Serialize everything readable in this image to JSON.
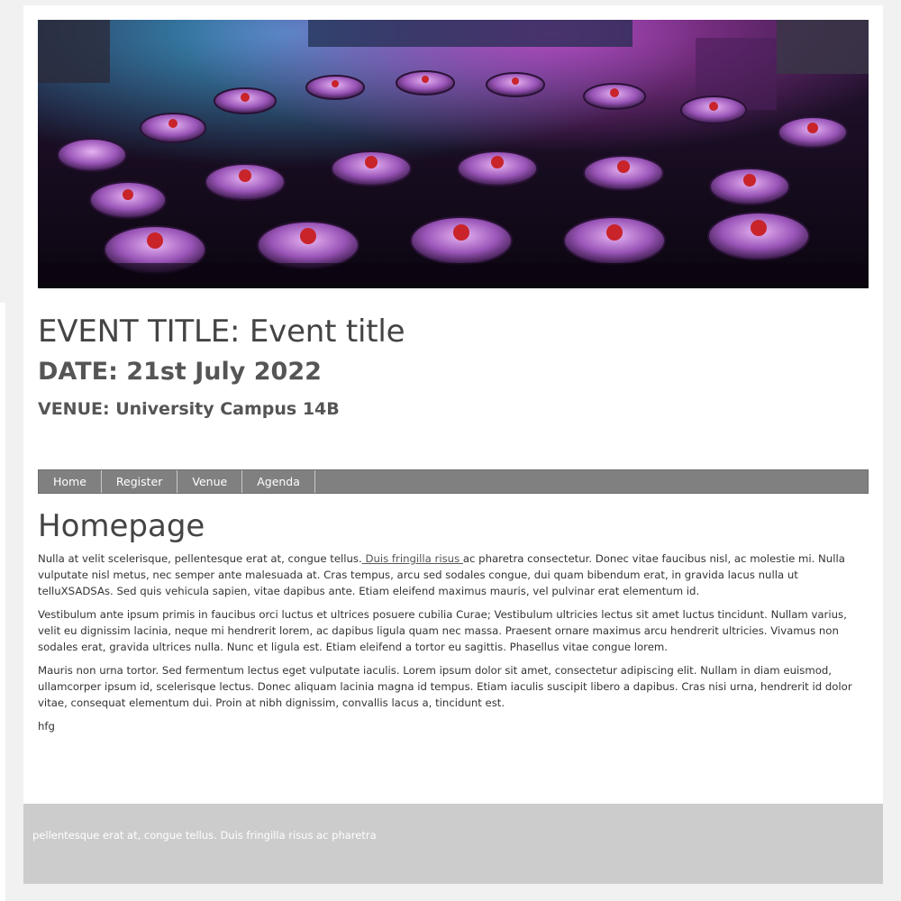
{
  "hero": {
    "image_label": "event-banner-banquet-hall"
  },
  "event": {
    "title": "EVENT TITLE: Event title",
    "date": "DATE: 21st July 2022",
    "venue": "VENUE: University Campus 14B"
  },
  "nav": {
    "items": [
      {
        "label": "Home"
      },
      {
        "label": "Register"
      },
      {
        "label": "Venue"
      },
      {
        "label": "Agenda"
      }
    ]
  },
  "main": {
    "heading": "Homepage",
    "p1_before_link": "Nulla at velit scelerisque, pellentesque erat at, congue tellus.",
    "p1_link": " Duis fringilla risus ",
    "p1_after_link": "ac pharetra consectetur. Donec vitae faucibus nisl, ac molestie mi. Nulla vulputate nisl metus, nec semper ante malesuada at. Cras tempus, arcu sed sodales congue, dui quam bibendum erat, in gravida lacus nulla ut telluXSADSAs. Sed quis vehicula sapien, vitae dapibus ante. Etiam eleifend maximus mauris, vel pulvinar erat elementum id.",
    "p2": "Vestibulum ante ipsum primis in faucibus orci luctus et ultrices posuere cubilia Curae; Vestibulum ultricies lectus sit amet luctus tincidunt. Nullam varius, velit eu dignissim lacinia, neque mi hendrerit lorem, ac dapibus ligula quam nec massa. Praesent ornare maximus arcu hendrerit ultricies. Vivamus non sodales erat, gravida ultrices nulla. Nunc et ligula est. Etiam eleifend a tortor eu sagittis. Phasellus vitae congue lorem.",
    "p3": "Mauris non urna tortor. Sed fermentum lectus eget vulputate iaculis. Lorem ipsum dolor sit amet, consectetur adipiscing elit. Nullam in diam euismod, ullamcorper ipsum id, scelerisque lectus. Donec aliquam lacinia magna id tempus. Etiam iaculis suscipit libero a dapibus. Cras nisi urna, hendrerit id dolor vitae, consequat elementum dui. Proin at nibh dignissim, convallis lacus a, tincidunt est.",
    "p4": "hfg"
  },
  "footer": {
    "text": "pellentesque erat at, congue tellus. Duis fringilla risus ac pharetra"
  },
  "colors": {
    "nav_bg": "#808080",
    "footer_bg": "#cccccc",
    "page_bg": "#f1f1f1",
    "text": "#444444"
  }
}
